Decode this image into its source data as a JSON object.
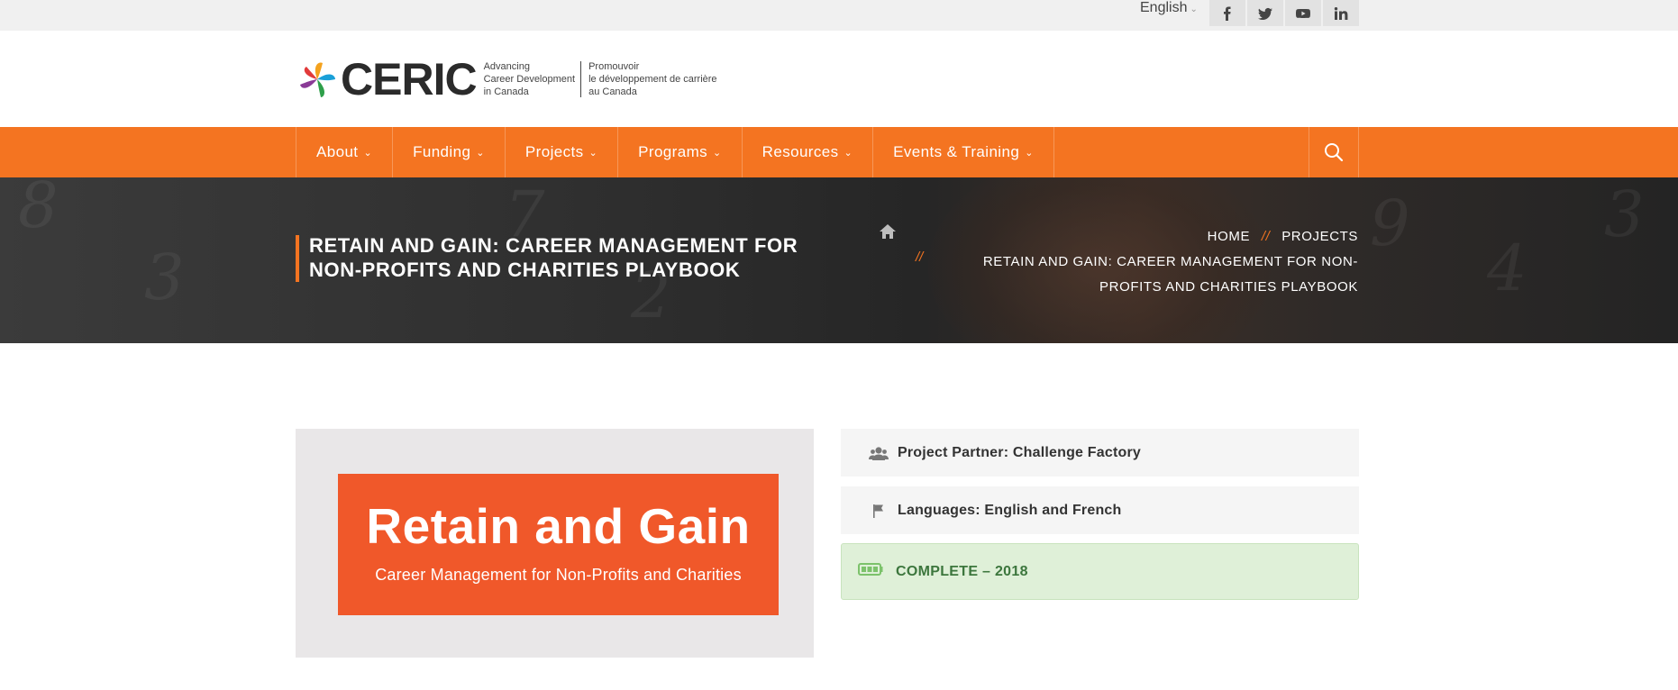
{
  "topbar": {
    "language": "English",
    "social": [
      "facebook-icon",
      "twitter-icon",
      "youtube-icon",
      "linkedin-icon"
    ]
  },
  "logo": {
    "wordmark": "CERIC",
    "tagline_en": [
      "Advancing",
      "Career Development",
      "in Canada"
    ],
    "tagline_fr": [
      "Promouvoir",
      "le développement de carrière",
      "au Canada"
    ]
  },
  "nav": {
    "items": [
      {
        "label": "About"
      },
      {
        "label": "Funding"
      },
      {
        "label": "Projects"
      },
      {
        "label": "Programs"
      },
      {
        "label": "Resources"
      },
      {
        "label": "Events & Training"
      }
    ]
  },
  "hero": {
    "title_line1": "RETAIN AND GAIN: CAREER MANAGEMENT FOR",
    "title_line2": "NON-PROFITS AND CHARITIES PLAYBOOK",
    "breadcrumb": {
      "home": "HOME",
      "separator": "//",
      "section": "PROJECTS",
      "current_line1": "RETAIN AND GAIN: CAREER MANAGEMENT FOR NON-",
      "current_line2": "PROFITS AND CHARITIES PLAYBOOK"
    }
  },
  "promo": {
    "headline": "Retain and Gain",
    "subhead": "Career Management for Non-Profits and Charities"
  },
  "details": {
    "partner": "Project Partner: Challenge Factory",
    "languages": "Languages: English and French",
    "status": "COMPLETE – 2018"
  },
  "colors": {
    "brand_orange": "#f47421",
    "promo_orange": "#f0582a",
    "status_green_bg": "#dff0d8",
    "status_green_text": "#3c763d"
  }
}
